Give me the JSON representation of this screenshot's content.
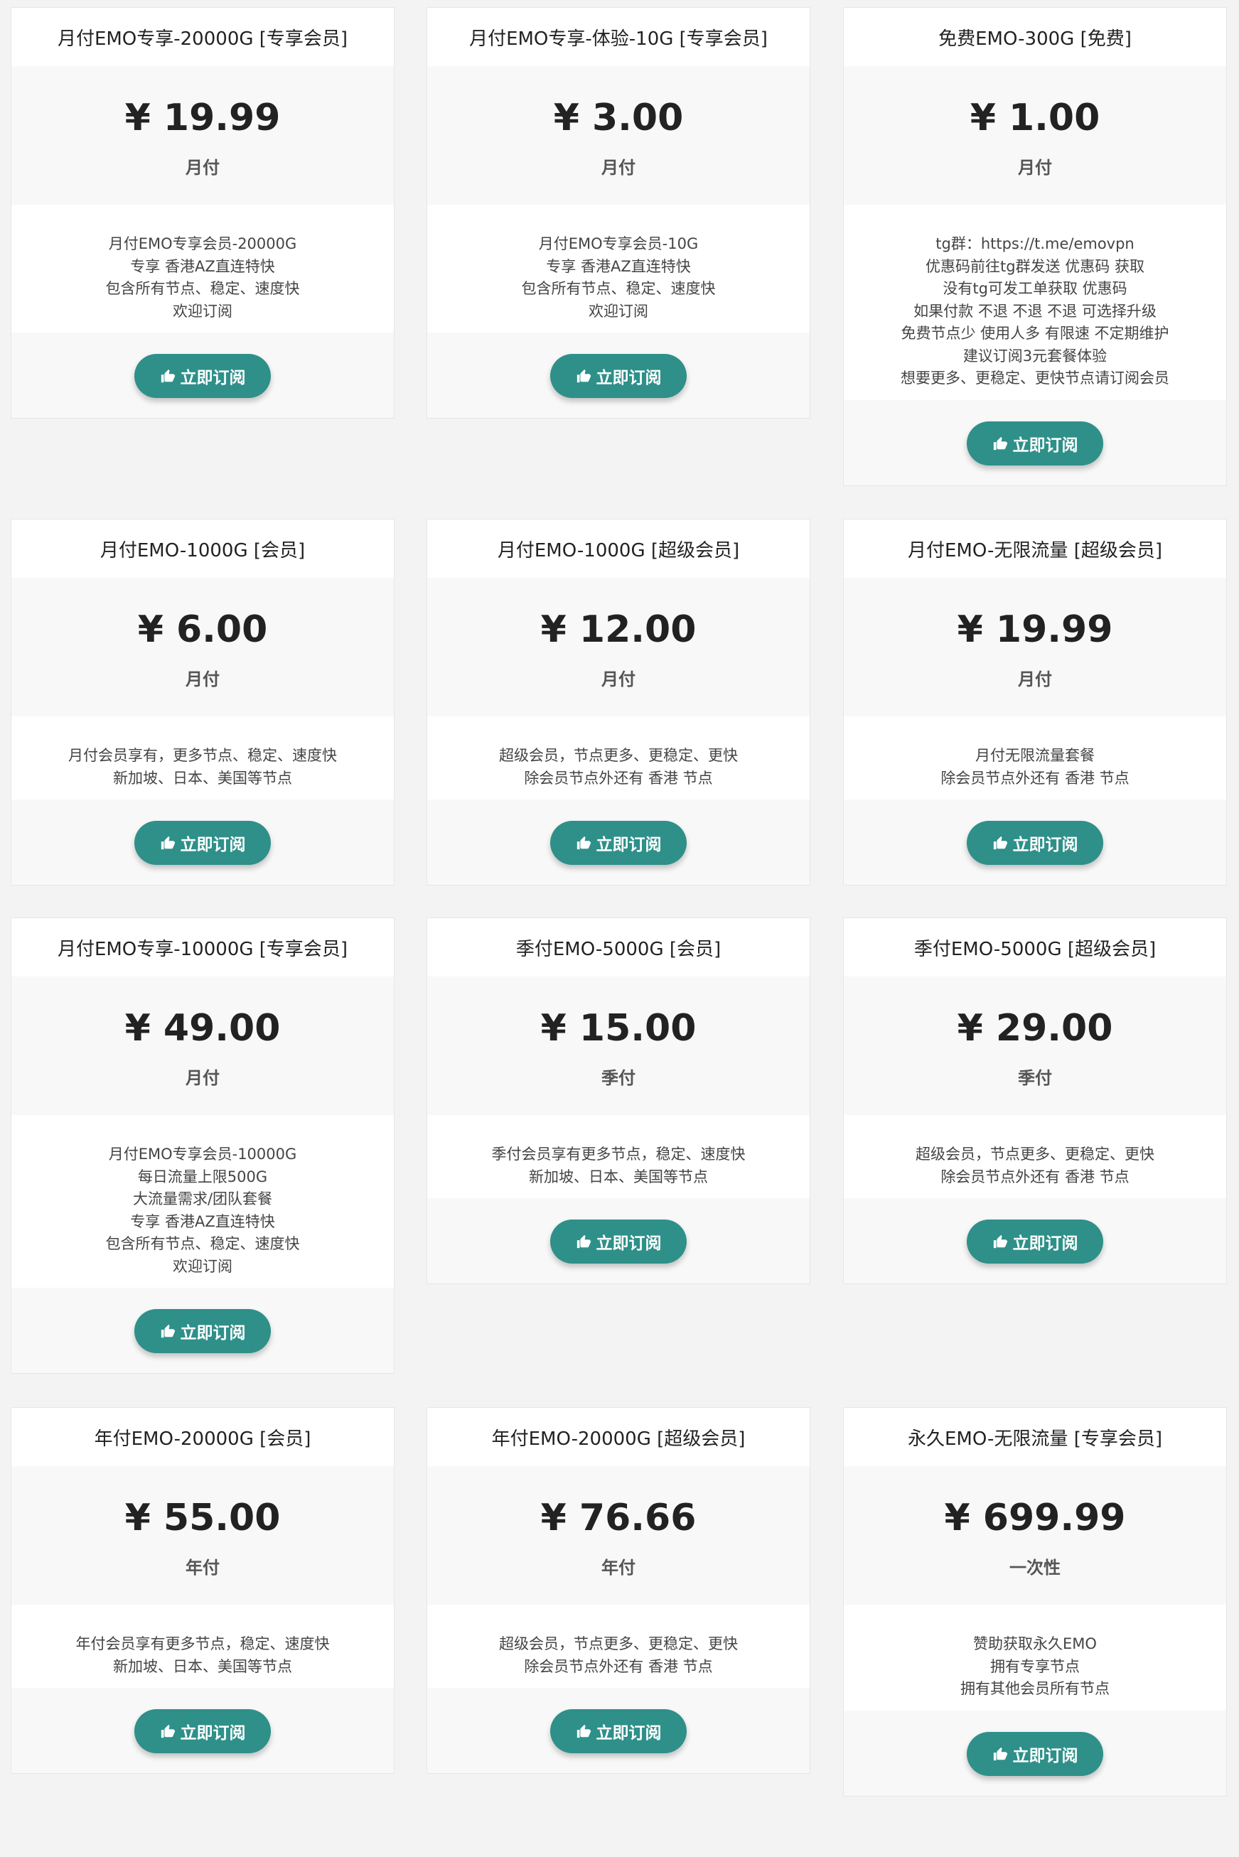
{
  "subscribe_label": "立即订阅",
  "accent_color": "#2e9089",
  "cards": [
    {
      "title": "月付EMO专享-20000G [专享会员]",
      "price": "¥ 19.99",
      "period": "月付",
      "desc": [
        "月付EMO专享会员-20000G",
        "专享 香港AZ直连特快",
        "包含所有节点、稳定、速度快",
        "欢迎订阅"
      ]
    },
    {
      "title": "月付EMO专享-体验-10G [专享会员]",
      "price": "¥ 3.00",
      "period": "月付",
      "desc": [
        "月付EMO专享会员-10G",
        "专享 香港AZ直连特快",
        "包含所有节点、稳定、速度快",
        "欢迎订阅"
      ]
    },
    {
      "title": "免费EMO-300G [免费]",
      "price": "¥ 1.00",
      "period": "月付",
      "desc": [
        "tg群：https://t.me/emovpn",
        "优惠码前往tg群发送 优惠码 获取",
        "没有tg可发工单获取 优惠码",
        "如果付款 不退 不退 不退 可选择升级",
        "免费节点少 使用人多 有限速 不定期维护",
        "建议订阅3元套餐体验",
        "想要更多、更稳定、更快节点请订阅会员"
      ]
    },
    {
      "title": "月付EMO-1000G [会员]",
      "price": "¥ 6.00",
      "period": "月付",
      "desc": [
        "月付会员享有，更多节点、稳定、速度快",
        "新加坡、日本、美国等节点"
      ]
    },
    {
      "title": "月付EMO-1000G [超级会员]",
      "price": "¥ 12.00",
      "period": "月付",
      "desc": [
        "超级会员，节点更多、更稳定、更快",
        "除会员节点外还有 香港 节点"
      ]
    },
    {
      "title": "月付EMO-无限流量 [超级会员]",
      "price": "¥ 19.99",
      "period": "月付",
      "desc": [
        "月付无限流量套餐",
        "除会员节点外还有 香港 节点"
      ]
    },
    {
      "title": "月付EMO专享-10000G [专享会员]",
      "price": "¥ 49.00",
      "period": "月付",
      "desc": [
        "月付EMO专享会员-10000G",
        "每日流量上限500G",
        "大流量需求/团队套餐",
        "专享 香港AZ直连特快",
        "包含所有节点、稳定、速度快",
        "欢迎订阅"
      ]
    },
    {
      "title": "季付EMO-5000G [会员]",
      "price": "¥ 15.00",
      "period": "季付",
      "desc": [
        "季付会员享有更多节点，稳定、速度快",
        "新加坡、日本、美国等节点"
      ]
    },
    {
      "title": "季付EMO-5000G [超级会员]",
      "price": "¥ 29.00",
      "period": "季付",
      "desc": [
        "超级会员，节点更多、更稳定、更快",
        "除会员节点外还有 香港 节点"
      ]
    },
    {
      "title": "年付EMO-20000G [会员]",
      "price": "¥ 55.00",
      "period": "年付",
      "desc": [
        "年付会员享有更多节点，稳定、速度快",
        "新加坡、日本、美国等节点"
      ]
    },
    {
      "title": "年付EMO-20000G [超级会员]",
      "price": "¥ 76.66",
      "period": "年付",
      "desc": [
        "超级会员，节点更多、更稳定、更快",
        "除会员节点外还有 香港 节点"
      ]
    },
    {
      "title": "永久EMO-无限流量 [专享会员]",
      "price": "¥ 699.99",
      "period": "一次性",
      "desc": [
        "赞助获取永久EMO",
        "拥有专享节点",
        "拥有其他会员所有节点"
      ]
    }
  ]
}
